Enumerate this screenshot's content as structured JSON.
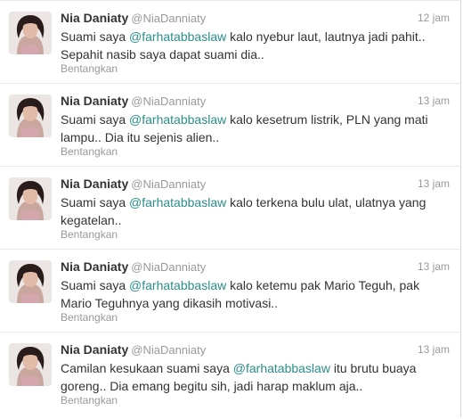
{
  "tweets": [
    {
      "fullname": "Nia Daniaty",
      "username": "@NiaDanniaty",
      "time": "12 jam",
      "text_before": "Suami saya ",
      "mention": "@farhatabbaslaw",
      "text_after": " kalo nyebur laut, lautnya jadi pahit.. Sepahit nasib saya dapat suami dia..",
      "expand": "Bentangkan"
    },
    {
      "fullname": "Nia Daniaty",
      "username": "@NiaDanniaty",
      "time": "13 jam",
      "text_before": "Suami saya ",
      "mention": "@farhatabbaslaw",
      "text_after": " kalo kesetrum listrik, PLN yang mati lampu.. Dia itu sejenis alien..",
      "expand": "Bentangkan"
    },
    {
      "fullname": "Nia Daniaty",
      "username": "@NiaDanniaty",
      "time": "13 jam",
      "text_before": "Suami saya ",
      "mention": "@farhatabbaslaw",
      "text_after": " kalo terkena bulu ulat, ulatnya yang kegatelan..",
      "expand": "Bentangkan"
    },
    {
      "fullname": "Nia Daniaty",
      "username": "@NiaDanniaty",
      "time": "13 jam",
      "text_before": "Suami saya ",
      "mention": "@farhatabbaslaw",
      "text_after": " kalo ketemu pak Mario Teguh, pak Mario Teguhnya yang dikasih motivasi..",
      "expand": "Bentangkan"
    },
    {
      "fullname": "Nia Daniaty",
      "username": "@NiaDanniaty",
      "time": "13 jam",
      "text_before": "Camilan kesukaan suami saya ",
      "mention": "@farhatabbaslaw",
      "text_after": " itu brutu buaya goreng.. Dia emang begitu sih, jadi harap maklum aja..",
      "expand": "Bentangkan"
    }
  ],
  "colors": {
    "mention": "#2a8e8a",
    "muted": "#999999",
    "text": "#333333"
  }
}
